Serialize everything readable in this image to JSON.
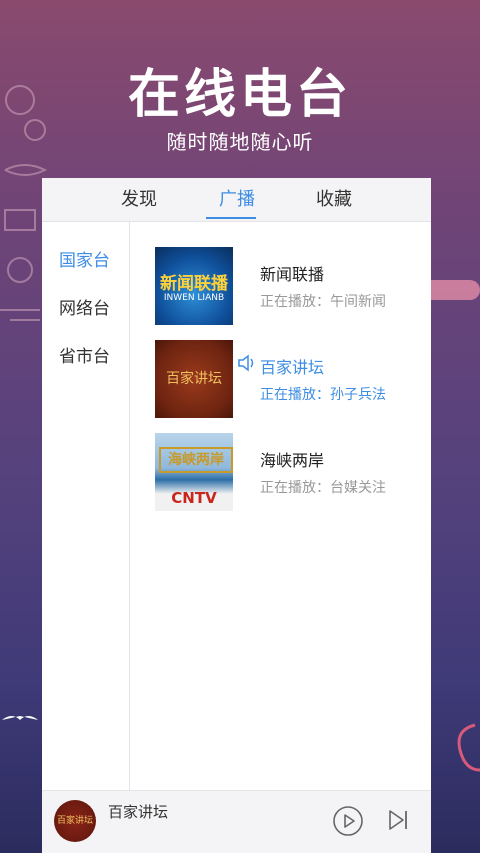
{
  "promo": {
    "title": "在线电台",
    "subtitle": "随时随地随心听"
  },
  "tabs": [
    {
      "label": "发现"
    },
    {
      "label": "广播"
    },
    {
      "label": "收藏"
    }
  ],
  "sidebar": {
    "items": [
      {
        "label": "国家台"
      },
      {
        "label": "网络台"
      },
      {
        "label": "省市台"
      }
    ]
  },
  "stations": [
    {
      "name": "新闻联播",
      "now_playing": "正在播放：午间新闻",
      "thumb_text": "新闻联播",
      "thumb_sub": "INWEN LIANB"
    },
    {
      "name": "百家讲坛",
      "now_playing": "正在播放：孙子兵法",
      "thumb_text": "百家讲坛"
    },
    {
      "name": "海峡两岸",
      "now_playing": "正在播放：台媒关注",
      "thumb_text": "海峡两岸",
      "thumb_sub": "CNTV"
    }
  ],
  "player": {
    "title": "百家讲坛",
    "art_text": "百家讲坛"
  },
  "colors": {
    "accent": "#3d8de4"
  }
}
